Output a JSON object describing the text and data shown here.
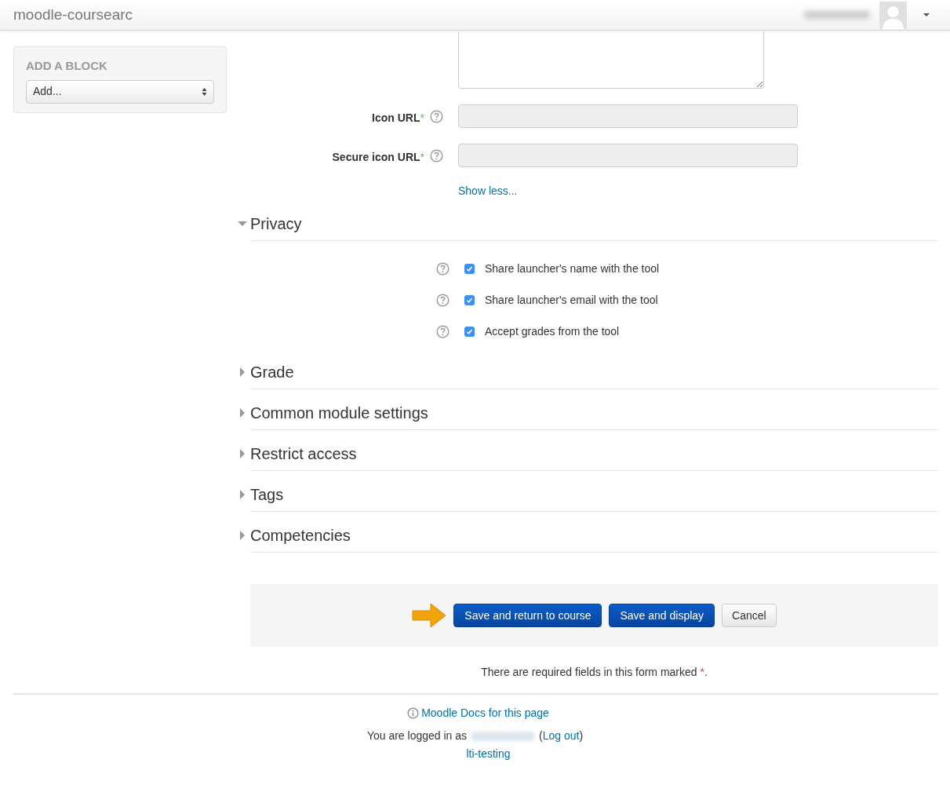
{
  "header": {
    "site_name": "moodle-coursearc"
  },
  "block": {
    "title": "ADD A BLOCK",
    "select": "Add..."
  },
  "fields": [
    {
      "kind": "textarea"
    },
    {
      "label": "Icon URL",
      "mark": "*",
      "kind": "text"
    },
    {
      "label": "Secure icon URL",
      "mark": "*",
      "kind": "text"
    }
  ],
  "show_less": "Show less...",
  "sections": [
    {
      "title": "Privacy",
      "expanded": true,
      "options": [
        {
          "label": "Share launcher's name with the tool",
          "checked": true
        },
        {
          "label": "Share launcher's email with the tool",
          "checked": true
        },
        {
          "label": "Accept grades from the tool",
          "checked": true
        }
      ]
    },
    {
      "title": "Grade",
      "expanded": false
    },
    {
      "title": "Common module settings",
      "expanded": false
    },
    {
      "title": "Restrict access",
      "expanded": false
    },
    {
      "title": "Tags",
      "expanded": false
    },
    {
      "title": "Competencies",
      "expanded": false
    }
  ],
  "buttons": [
    {
      "label": "Save and return to course",
      "kind": "primary"
    },
    {
      "label": "Save and display",
      "kind": "primary"
    },
    {
      "label": "Cancel",
      "kind": "default"
    }
  ],
  "required_note": {
    "text": "There are required fields in this form marked",
    "mark": "*",
    "end": "."
  },
  "footer": {
    "docs_link": "Moodle Docs for this page",
    "logged_in": "You are logged in as",
    "open": "(",
    "logout": "Log out",
    "close": ")",
    "course_link": "lti-testing"
  }
}
